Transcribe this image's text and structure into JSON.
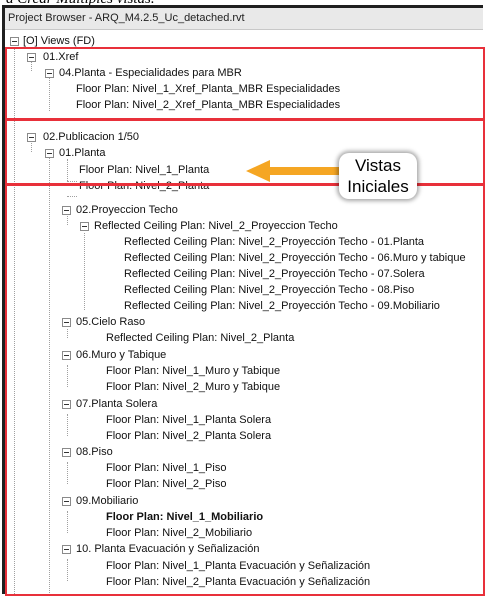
{
  "caption": "a Crear Múltiples vistas.",
  "window": {
    "title": "Project Browser - ARQ_M4.2.5_Uc_detached.rvt"
  },
  "tree": {
    "views_root": "[O] Views (FD)",
    "xref_group": "01.Xref",
    "xref_sub": "04.Planta - Especialidades para MBR",
    "xref_items": [
      "Floor Plan: Nivel_1_Xref_Planta_MBR Especialidades",
      "Floor Plan: Nivel_2_Xref_Planta_MBR Especialidades"
    ],
    "pub_group": "02.Publicacion 1/50",
    "planta_group": "01.Planta",
    "planta_items": [
      "Floor Plan: Nivel_1_Planta",
      "Floor Plan: Nivel_2_Planta"
    ],
    "techo_group": "02.Proyeccion Techo",
    "techo_parent": "Reflected Ceiling Plan: Nivel_2_Proyeccion Techo",
    "techo_items": [
      "Reflected Ceiling Plan: Nivel_2_Proyección Techo - 01.Planta",
      "Reflected Ceiling Plan: Nivel_2_Proyección Techo - 06.Muro y tabique",
      "Reflected Ceiling Plan: Nivel_2_Proyección Techo - 07.Solera",
      "Reflected Ceiling Plan: Nivel_2_Proyección Techo - 08.Piso",
      "Reflected Ceiling Plan: Nivel_2_Proyección Techo - 09.Mobiliario"
    ],
    "cielo_group": "05.Cielo Raso",
    "cielo_items": [
      "Reflected Ceiling Plan: Nivel_2_Planta"
    ],
    "muro_group": "06.Muro y Tabique",
    "muro_items": [
      "Floor Plan: Nivel_1_Muro y Tabique",
      "Floor Plan: Nivel_2_Muro y Tabique"
    ],
    "solera_group": "07.Planta Solera",
    "solera_items": [
      "Floor Plan: Nivel_1_Planta Solera",
      "Floor Plan: Nivel_2_Planta Solera"
    ],
    "piso_group": "08.Piso",
    "piso_items": [
      "Floor Plan: Nivel_1_Piso",
      "Floor Plan: Nivel_2_Piso"
    ],
    "mob_group": "09.Mobiliario",
    "mob_items": [
      "Floor Plan: Nivel_1_Mobiliario",
      "Floor Plan: Nivel_2_Mobiliario"
    ],
    "evac_group": "10. Planta Evacuación y Señalización",
    "evac_items": [
      "Floor Plan: Nivel_1_Planta Evacuación y Señalización",
      "Floor Plan: Nivel_2_Planta Evacuación y Señalización"
    ],
    "active_item": "Floor Plan: Nivel_1_Mobiliario"
  },
  "annotation": {
    "line1": "Vistas",
    "line2": "Iniciales",
    "box_color": "#e8303a",
    "arrow_color": "#f5a623"
  }
}
